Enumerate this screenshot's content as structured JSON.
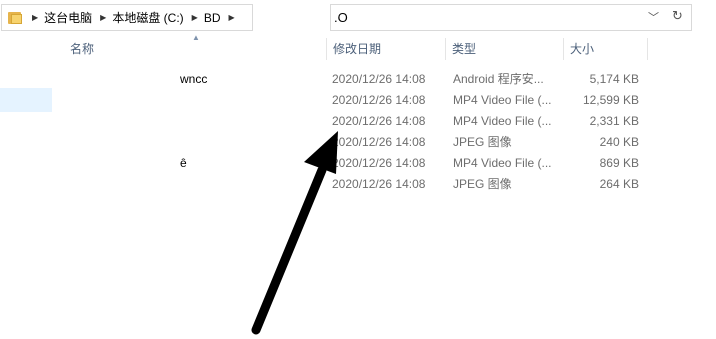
{
  "address_bar": {
    "crumbs": [
      "这台电脑",
      "本地磁盘 (C:)",
      "BD"
    ]
  },
  "search": {
    "value": ".O"
  },
  "columns": {
    "name": "名称",
    "date": "修改日期",
    "type": "类型",
    "size": "大小"
  },
  "rows": [
    {
      "name": "wncc",
      "date": "2020/12/26 14:08",
      "type": "Android 程序安...",
      "size": "5,174 KB"
    },
    {
      "name": "",
      "date": "2020/12/26 14:08",
      "type": "MP4 Video File (...",
      "size": "12,599 KB"
    },
    {
      "name": "",
      "date": "2020/12/26 14:08",
      "type": "MP4 Video File (...",
      "size": "2,331 KB"
    },
    {
      "name": "",
      "date": "2020/12/26 14:08",
      "type": "JPEG 图像",
      "size": "240 KB"
    },
    {
      "name": "ê",
      "date": "2020/12/26 14:08",
      "type": "MP4 Video File (...",
      "size": "869 KB"
    },
    {
      "name": "",
      "date": "2020/12/26 14:08",
      "type": "JPEG 图像",
      "size": "264 KB"
    }
  ],
  "colors": {
    "header_text": "#4c607a",
    "detail_text": "#6d6d6d",
    "selection": "#e5f3ff",
    "arrow": "#000000"
  },
  "icons": [
    "folder-icon",
    "chevron-right-icon",
    "chevron-down-icon",
    "refresh-icon",
    "sort-up-icon",
    "arrow-annotation"
  ]
}
